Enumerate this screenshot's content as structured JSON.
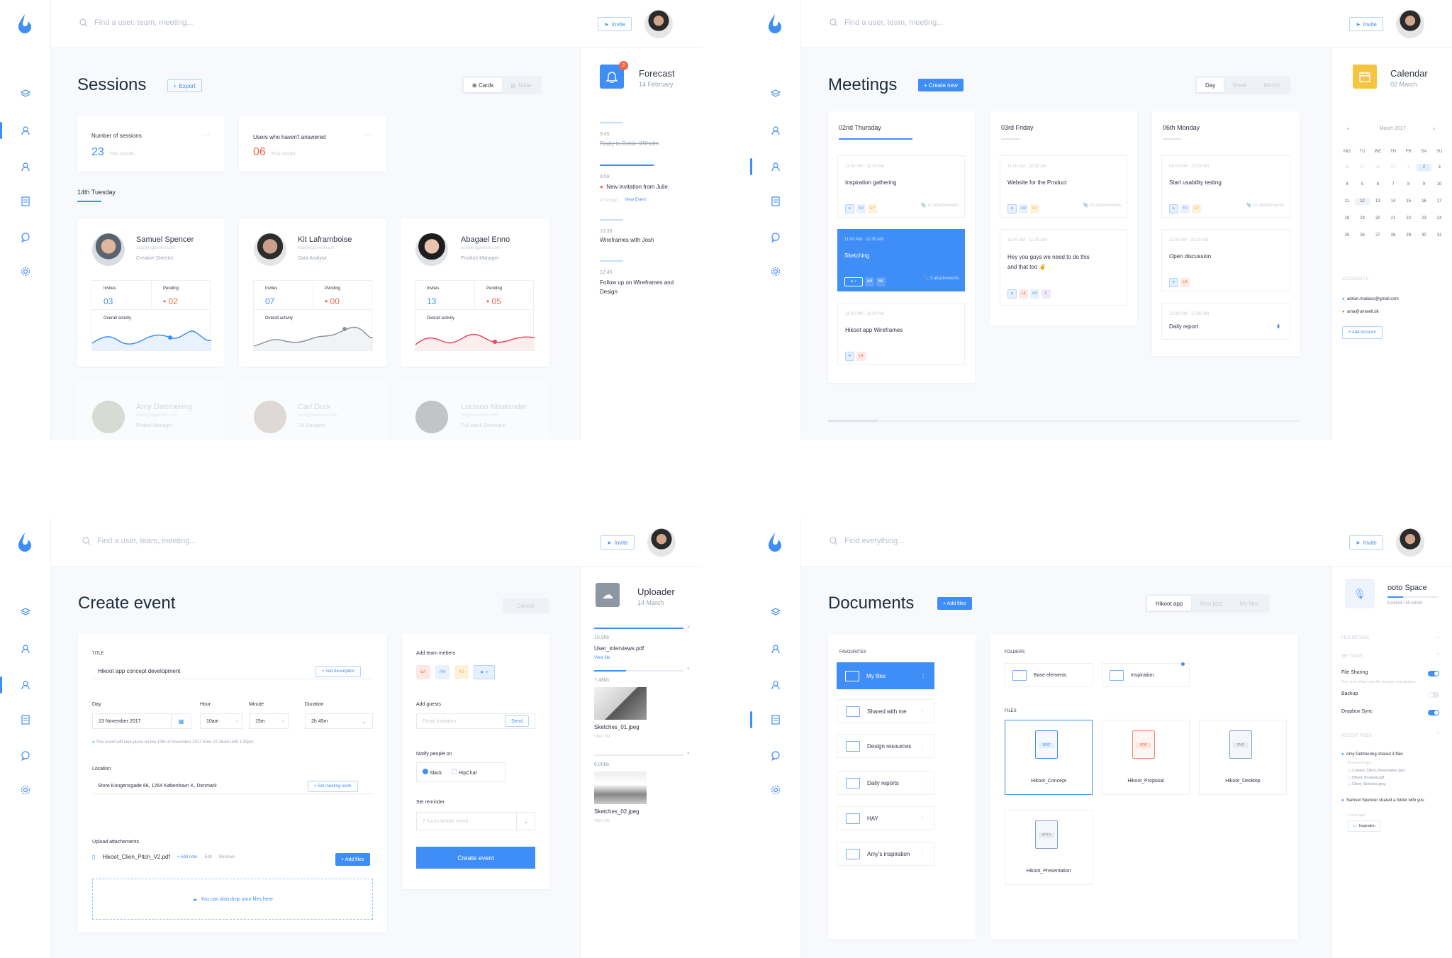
{
  "colors": {
    "accent": "#3f8ef7",
    "danger": "#f56545",
    "warning": "#f5c542"
  },
  "topbar": {
    "search_placeholder": "Find a user, team, meeting...",
    "search_placeholder_docs": "Find everything...",
    "invite_label": "Invite"
  },
  "sessions": {
    "title": "Sessions",
    "export_label": "Export",
    "view_cards": "Cards",
    "view_table": "Table",
    "stats": [
      {
        "label": "Number of sessions",
        "value": "23",
        "sub": "This month"
      },
      {
        "label": "Users  who haven't answered",
        "value": "06",
        "sub": "This month"
      }
    ],
    "day_label": "14th Tuesday",
    "users": [
      {
        "name": "Samuel Spencer",
        "email": "sasp@egament.com",
        "role": "Creative Director",
        "invites": "03",
        "pending": "02",
        "activity": "Overall activity"
      },
      {
        "name": "Kit Laframboise",
        "email": "kila@egament.com",
        "role": "Data Analysit",
        "invites": "07",
        "pending": "00",
        "activity": "Overall activity"
      },
      {
        "name": "Abagael Enno",
        "email": "anhu@egament.com",
        "role": "Product Manager",
        "invites": "13",
        "pending": "05",
        "activity": "Overall activity"
      }
    ],
    "users_faded": [
      {
        "name": "Amy Dettmering",
        "email": "amde@egament.com",
        "role": "Project Manager"
      },
      {
        "name": "Carl Durk",
        "email": "cadu@egament.com",
        "role": "UX Designer"
      },
      {
        "name": "Luciano Niswander",
        "email": "luni@egament.com",
        "role": "Full-stack Developer"
      }
    ],
    "invites_label": "Invites",
    "pending_label": "Pending",
    "forecast": {
      "title": "Forecast",
      "date": "14 February",
      "badge": "2",
      "items": [
        {
          "time": "9:45",
          "text": "Reply to Debie Wilhelm"
        },
        {
          "time": "9:59",
          "text": "New invitation from Julie",
          "accept": "Accept",
          "view": "View Event"
        },
        {
          "time": "10:30",
          "text": "Wireframes with Josh"
        },
        {
          "time": "12:45",
          "text": "Follow up on Wireframes and Design"
        }
      ]
    }
  },
  "meetings": {
    "title": "Meetings",
    "create_label": "+ Create new",
    "views": [
      "Day",
      "Week",
      "Month"
    ],
    "columns": [
      {
        "day": "02nd Thursday",
        "events": [
          {
            "time": "11:00 AM - 11:30 AM",
            "title": "Inspiration gathering",
            "tags": [
              "AM",
              "EV"
            ],
            "att": "10 attachements"
          },
          {
            "time": "11:00 AM - 11:30 AM",
            "title": "Sketching",
            "tags": [
              "AM",
              "BK"
            ],
            "att": "3 attachements"
          },
          {
            "time": "11:00 AM - 11:30 AM",
            "title": "Hikoot app Wireframes",
            "tags": [
              "LA"
            ],
            "att": ""
          }
        ]
      },
      {
        "day": "03rd Friday",
        "events": [
          {
            "time": "11:00 AM - 11:30 AM",
            "title": "Website for the Product",
            "tags": [
              "AM",
              "EV"
            ],
            "att": "10 attachements"
          },
          {
            "time": "11:00 AM - 11:30 AM",
            "title": "Hey you guys we need to do this and that too ✌️",
            "tags": [
              "LA",
              "AM",
              "F"
            ],
            "att": ""
          }
        ]
      },
      {
        "day": "06th Monday",
        "events": [
          {
            "time": "09:00 AM - 13:25 AM",
            "title": "Start usability testing",
            "tags": [
              "TK",
              "EV"
            ],
            "att": "10 attachements"
          },
          {
            "time": "11:00 AM - 11:30 AM",
            "title": "Open discussion",
            "tags": [
              "LA"
            ],
            "att": ""
          },
          {
            "time": "15:30 AM - 17:00 AM",
            "title": "Daily report",
            "tags": [],
            "att": ""
          }
        ]
      }
    ],
    "calendar": {
      "title": "Calendar",
      "date": "02 March",
      "month": "March 2017",
      "dow": [
        "MO",
        "TU",
        "WE",
        "TH",
        "FR",
        "SA",
        "SU"
      ],
      "days": [
        "26",
        "27",
        "28",
        "29",
        "1",
        "2",
        "3",
        "4",
        "5",
        "6",
        "7",
        "8",
        "9",
        "10",
        "11",
        "12",
        "13",
        "14",
        "15",
        "16",
        "17",
        "18",
        "19",
        "20",
        "21",
        "22",
        "23",
        "24",
        "25",
        "26",
        "27",
        "28",
        "29",
        "30",
        "31"
      ],
      "accounts_label": "ACCOUNTS",
      "accounts": [
        "adrian.madacs@gmail.com",
        "ama@umwelt.dk"
      ],
      "add_account": "+ Add Account"
    }
  },
  "create": {
    "title": "Create event",
    "cancel": "Cancel",
    "title_label": "TITLE",
    "title_value": "Hikoot app concept development",
    "add_desc": "+ Add description",
    "day_label": "Day",
    "day_value": "13 November 2017",
    "hour_label": "Hour",
    "hour_value": "10am",
    "minute_label": "Minute",
    "minute_value": "15m",
    "duration_label": "Duration",
    "duration_value": "2h 45m",
    "note": "This event will take place on the 13th of November 2017 from 10:15am until 1:00pm",
    "location_label": "Location",
    "location_value": "Store Kongensgade 66, 1264 København K, Denmark",
    "set_room": "+ Set meeting room",
    "upload_label": "Upload attachements",
    "file_name": "Hikoot_Clien_Pitch_V2.pdf",
    "add_note": "+ Add note",
    "edit": "Edit",
    "remove": "Remove",
    "add_files": "+ Add files",
    "drop": "You can also drop your files here",
    "team_label": "Add team mebers",
    "team": [
      "LA",
      "AM",
      "AS"
    ],
    "guests_label": "Add guests",
    "guest_placeholder": "Email invitation",
    "send": "Send",
    "notify_label": "Notify people on",
    "notify": [
      "Slack",
      "HipChat"
    ],
    "reminder_label": "Set reminder",
    "reminder_value": "2 hours before event",
    "create_btn": "Create event",
    "uploader": {
      "title": "Uploader",
      "date": "14 March",
      "files": [
        {
          "size": "10,9kb",
          "name": "User_interviews.pdf",
          "link": "View file"
        },
        {
          "size": "7,48kb",
          "name": "Sketches_01.jpeg",
          "link": "View file"
        },
        {
          "size": "6,00kb",
          "name": "Sketches_02.jpeg",
          "link": "View file"
        }
      ]
    }
  },
  "documents": {
    "title": "Documents",
    "add_files": "+ Add files",
    "tabs": [
      "Hikoot app",
      "New bizz",
      "My files"
    ],
    "fav_label": "FAVOURITES",
    "favourites": [
      "My files",
      "Shared with me",
      "Design resources",
      "Daily reports",
      "HAY",
      "Amy's inspiration"
    ],
    "folders_label": "FOLDERS",
    "folders": [
      "Base elements",
      "Inspiration"
    ],
    "files_label": "FILES",
    "files": [
      {
        "name": "Hikoot_Concept",
        "ext": "DOC"
      },
      {
        "name": "Hikoot_Proposal",
        "ext": "PDF"
      },
      {
        "name": "Hikoot_Desktop",
        "ext": "PNG"
      },
      {
        "name": "Hikoot_Presentation",
        "ext": "PPTX"
      }
    ],
    "space": {
      "title": "ooto Space",
      "usage": "8,08GB / 40,53GB",
      "file_details": "FILE DETAILS",
      "settings": "SETTINGS",
      "file_sharing": "File Sharing",
      "sharing_note": "Turn on to share your file changes and updates",
      "backup": "Backup",
      "dropbox": "Dropbox Sync",
      "recent": "RECENT FILES",
      "activity": [
        {
          "text": "Amy Dettmering shared 3 files",
          "time": "A moment ago",
          "files": [
            "Content_Client_Presentation.pptx",
            "Hikoot_Proposal.pdf",
            "Client_Sketches.jpeg"
          ]
        },
        {
          "text": "Samuel Spencer shared a folder with you",
          "time": "1 hour ago",
          "folder": "Inspiration"
        }
      ]
    }
  }
}
